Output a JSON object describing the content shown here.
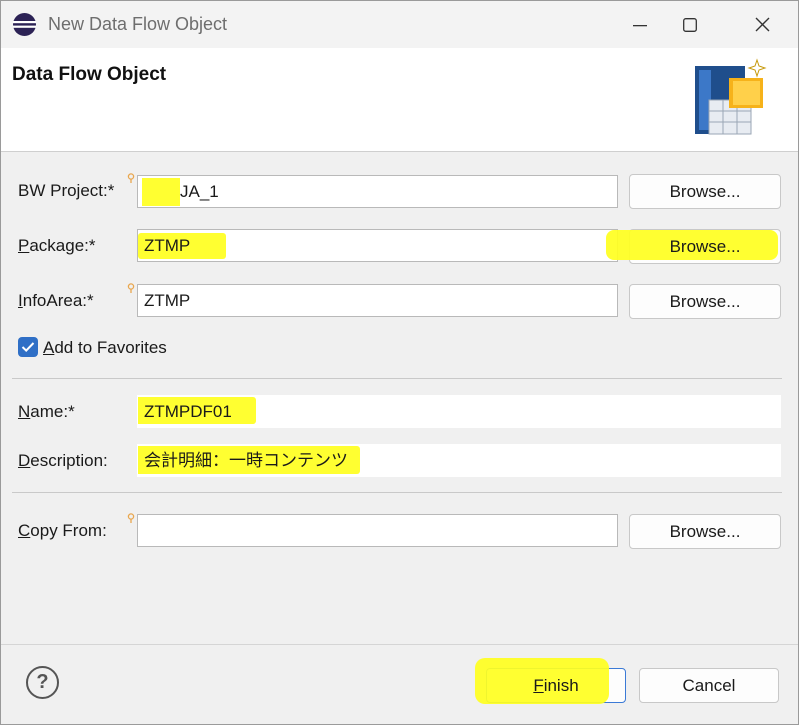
{
  "window": {
    "title": "New Data Flow Object",
    "minimize_icon": "minimize-icon",
    "maximize_icon": "maximize-icon",
    "close_icon": "close-icon"
  },
  "banner": {
    "title": "Data Flow Object",
    "icon": "data-flow-wizard-icon"
  },
  "form": {
    "bw_project": {
      "label": "BW Project:*",
      "value": "JA_1",
      "button": "Browse..."
    },
    "package": {
      "label_prefix": "",
      "label_underlined": "P",
      "label_rest": "ackage:*",
      "value": "ZTMP",
      "button": "Browse..."
    },
    "infoarea": {
      "label_underlined": "I",
      "label_rest": "nfoArea:*",
      "value": "ZTMP",
      "button": "Browse..."
    },
    "add_to_favorites": {
      "label_underlined": "A",
      "label_rest": "dd to Favorites",
      "checked": true
    },
    "name": {
      "label_underlined": "N",
      "label_rest": "ame:*",
      "value": "ZTMPDF01"
    },
    "description": {
      "label_underlined": "D",
      "label_rest": "escription:",
      "value": "会計明細：一時コンテンツ"
    },
    "copy_from": {
      "label_underlined": "C",
      "label_rest": "opy From:",
      "value": "",
      "button": "Browse..."
    }
  },
  "footer": {
    "help_icon": "help-icon",
    "help_glyph": "?",
    "finish_underlined": "F",
    "finish_rest": "inish",
    "cancel": "Cancel"
  },
  "colors": {
    "highlight": "#ffff1f",
    "checkbox": "#2f6fc6",
    "default_button_border": "#3b7ad6"
  }
}
